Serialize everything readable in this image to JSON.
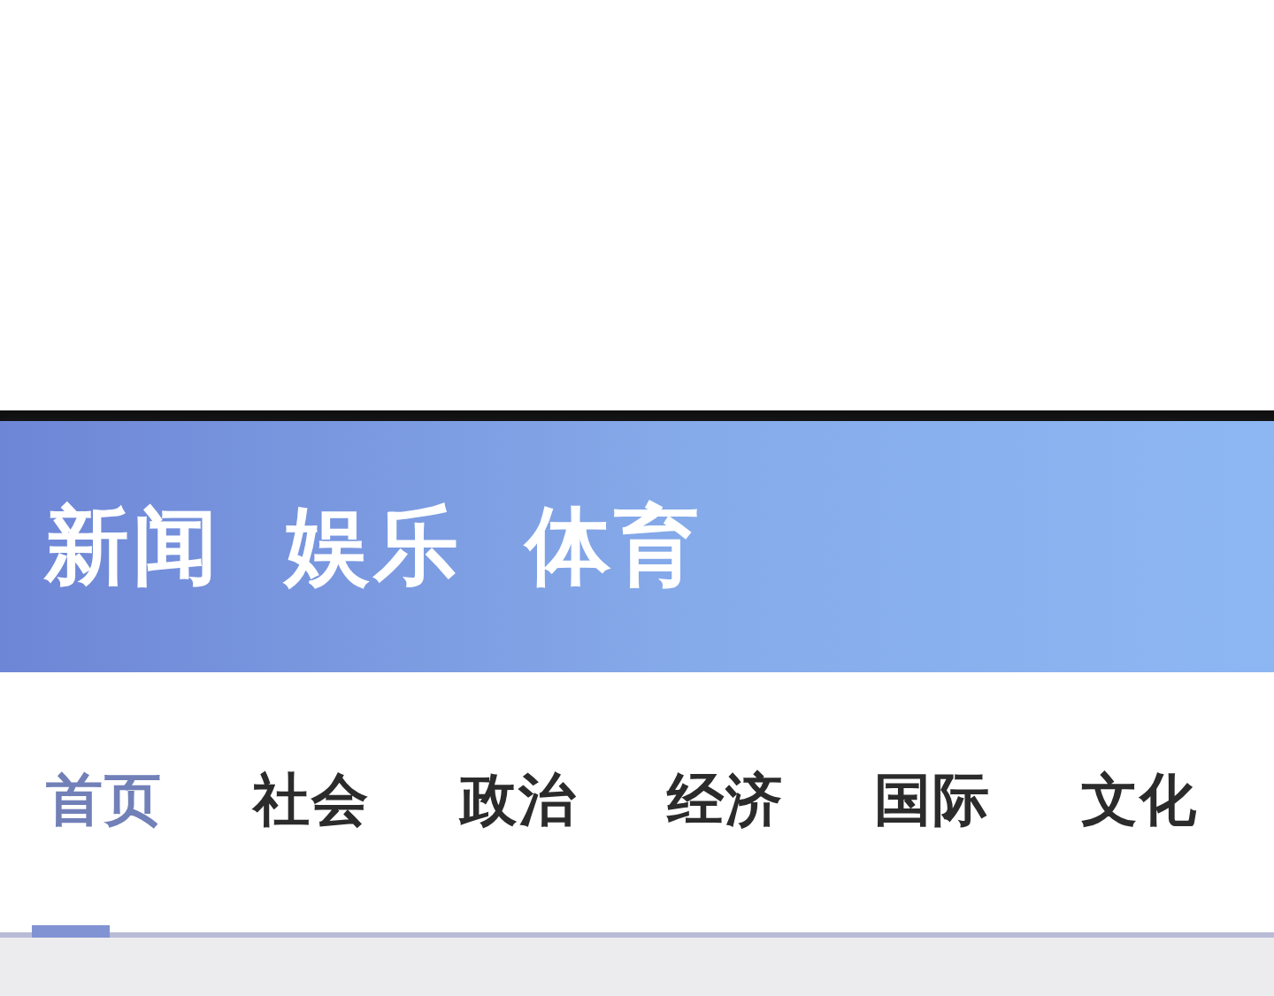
{
  "banner": {
    "words": [
      "新闻",
      "娱乐",
      "体育"
    ]
  },
  "tabs": [
    {
      "label": "首页",
      "selected": true
    },
    {
      "label": "社会",
      "selected": false
    },
    {
      "label": "政治",
      "selected": false
    },
    {
      "label": "经济",
      "selected": false
    },
    {
      "label": "国际",
      "selected": false
    },
    {
      "label": "文化",
      "selected": false
    }
  ]
}
